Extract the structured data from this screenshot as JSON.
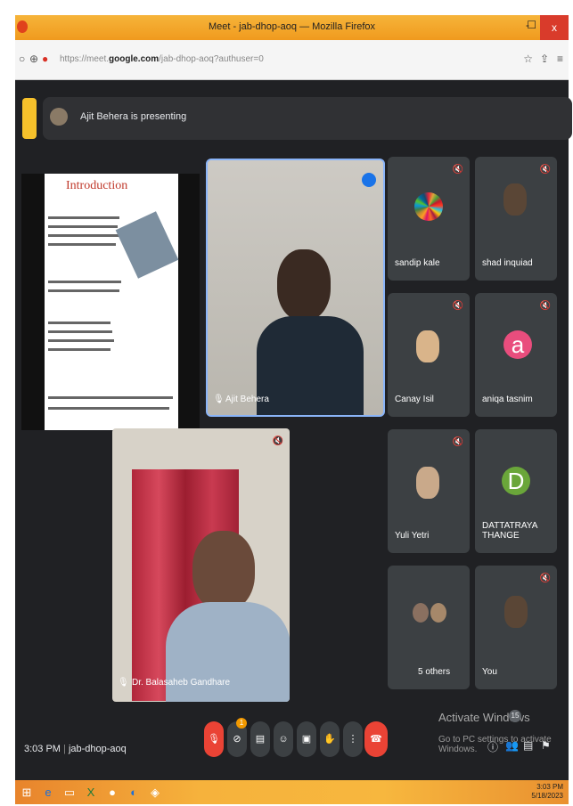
{
  "browser": {
    "window_title": "Meet - jab-dhop-aoq — Mozilla Firefox",
    "url_prefix": "https://meet.",
    "url_domain": "google.com",
    "url_path": "/jab-dhop-aoq?authuser=0",
    "min": "-",
    "max": "☐",
    "close": "x"
  },
  "meet": {
    "presenting_text": "Ajit Behera is presenting",
    "slide_title": "Introduction",
    "participants": [
      {
        "name": "sandip kale"
      },
      {
        "name": "shad inquiad"
      },
      {
        "name": "Canay Isil"
      },
      {
        "name": "aniqa tasnim",
        "initial": "a",
        "color": "#e94d7d"
      },
      {
        "name": "Yuli Yetri"
      },
      {
        "name": "DATTATRAYA THANGE",
        "initial": "D",
        "color": "#6aa63a"
      },
      {
        "name": "5 others"
      },
      {
        "name": "You"
      }
    ],
    "presenter_name": "Ajit Behera",
    "big_name": "Dr. Balasaheb Gandhare",
    "time": "3:03 PM",
    "meeting_code": "jab-dhop-aoq",
    "badge_count": "15",
    "chat_badge": "1"
  },
  "windows": {
    "activate_title": "Activate Windows",
    "activate_sub": "Go to PC settings to activate Windows.",
    "clock_time": "3:03 PM",
    "clock_date": "5/18/2023"
  }
}
